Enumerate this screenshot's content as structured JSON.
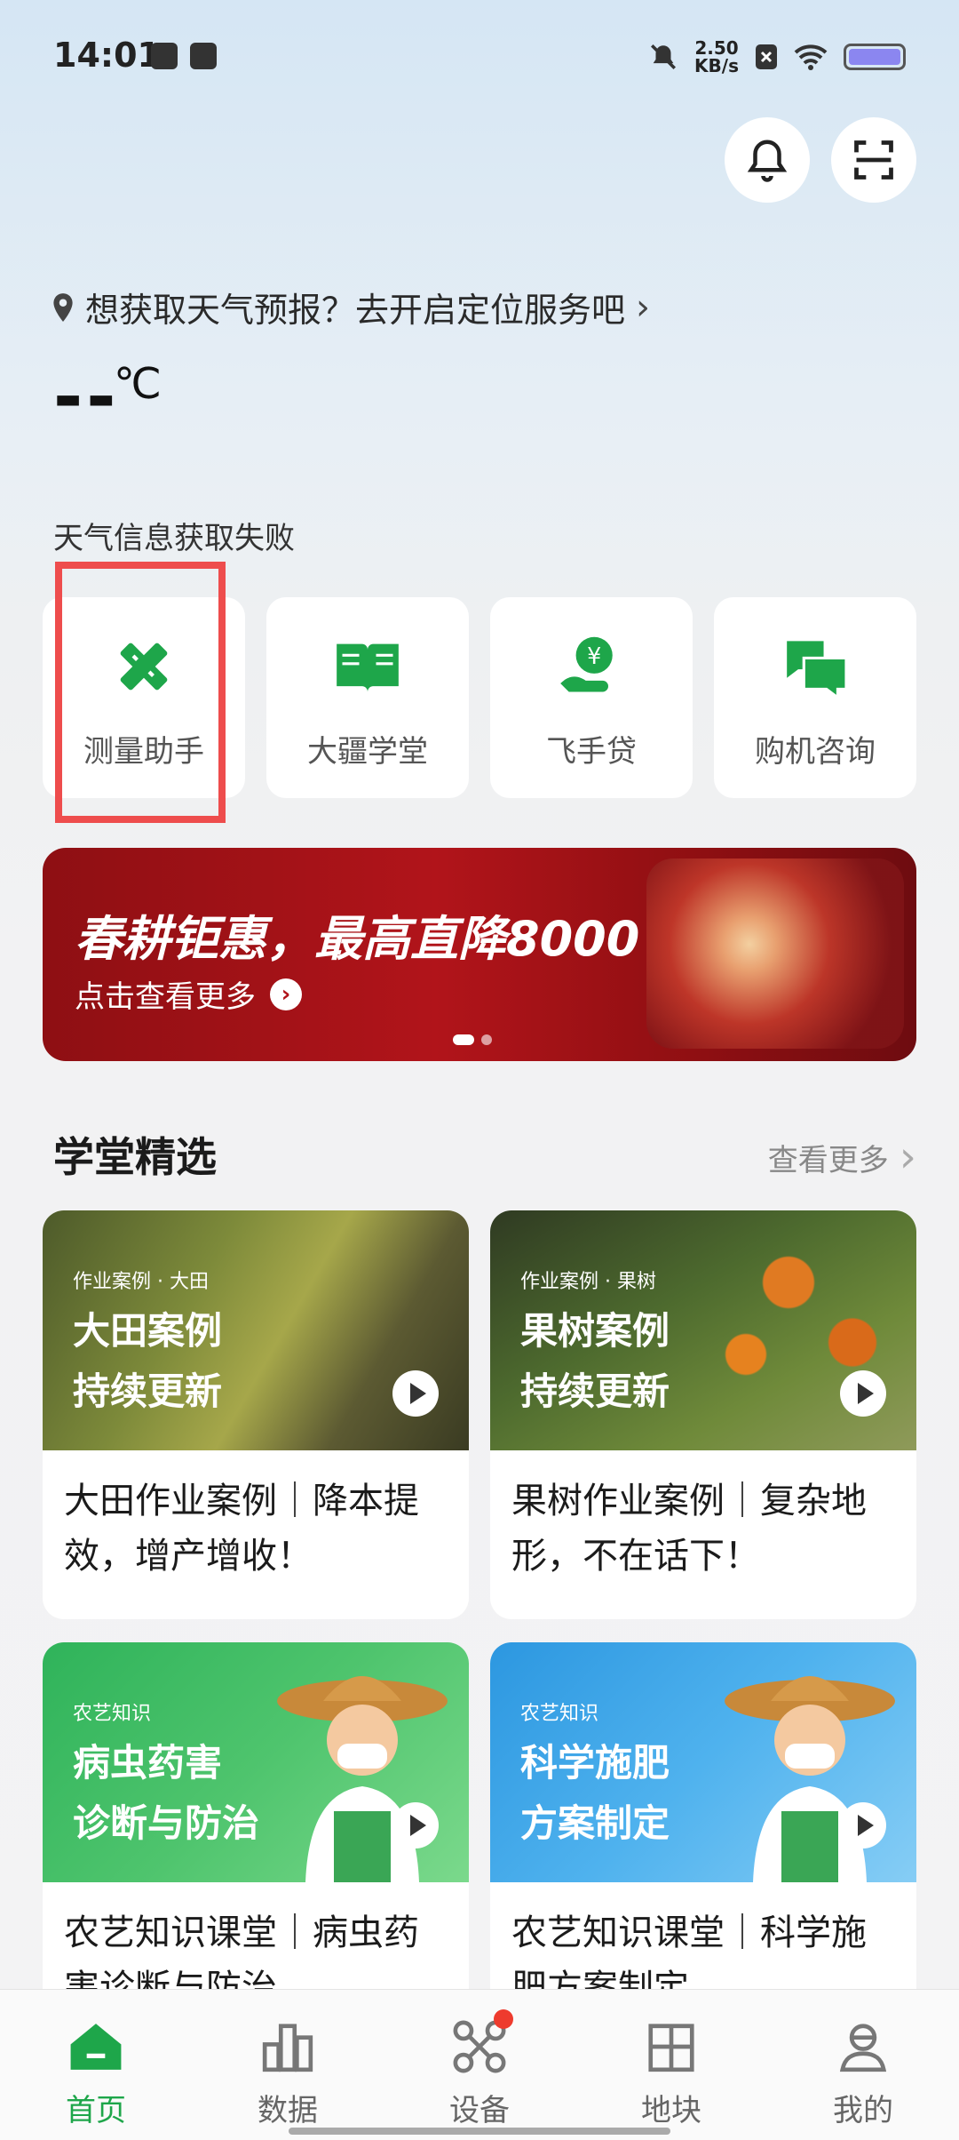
{
  "status_bar": {
    "time": "14:01",
    "net_speed_top": "2.50",
    "net_speed_unit": "KB/s"
  },
  "location": {
    "text": "想获取天气预报？去开启定位服务吧",
    "icon": "location-pin-icon"
  },
  "weather": {
    "temperature": "--",
    "unit": "℃",
    "status": "天气信息获取失败"
  },
  "tools": [
    {
      "label": "测量助手",
      "icon": "ruler-icon"
    },
    {
      "label": "大疆学堂",
      "icon": "book-icon"
    },
    {
      "label": "飞手贷",
      "icon": "loan-icon"
    },
    {
      "label": "购机咨询",
      "icon": "chat-icon"
    }
  ],
  "banner": {
    "title": "春耕钜惠，最高直降8000",
    "subtitle": "点击查看更多"
  },
  "section": {
    "title": "学堂精选",
    "more": "查看更多"
  },
  "cards": [
    {
      "tag": "作业案例 · 大田",
      "head1": "大田案例",
      "head2": "持续更新",
      "text": "大田作业案例｜降本提效，增产增收！"
    },
    {
      "tag": "作业案例 · 果树",
      "head1": "果树案例",
      "head2": "持续更新",
      "text": "果树作业案例｜复杂地形，不在话下！"
    },
    {
      "tag": "农艺知识",
      "head1": "病虫药害",
      "head2": "诊断与防治",
      "text": "农艺知识课堂｜病虫药害诊断与防治"
    },
    {
      "tag": "农艺知识",
      "head1": "科学施肥",
      "head2": "方案制定",
      "text": "农艺知识课堂｜科学施肥方案制定"
    }
  ],
  "nav": [
    {
      "label": "首页",
      "icon": "home-icon"
    },
    {
      "label": "数据",
      "icon": "bar-chart-icon"
    },
    {
      "label": "设备",
      "icon": "drone-icon"
    },
    {
      "label": "地块",
      "icon": "field-grid-icon"
    },
    {
      "label": "我的",
      "icon": "user-icon"
    }
  ],
  "colors": {
    "accent": "#1ea64a",
    "highlight": "#ee4d4d",
    "banner": "#b1141a"
  }
}
